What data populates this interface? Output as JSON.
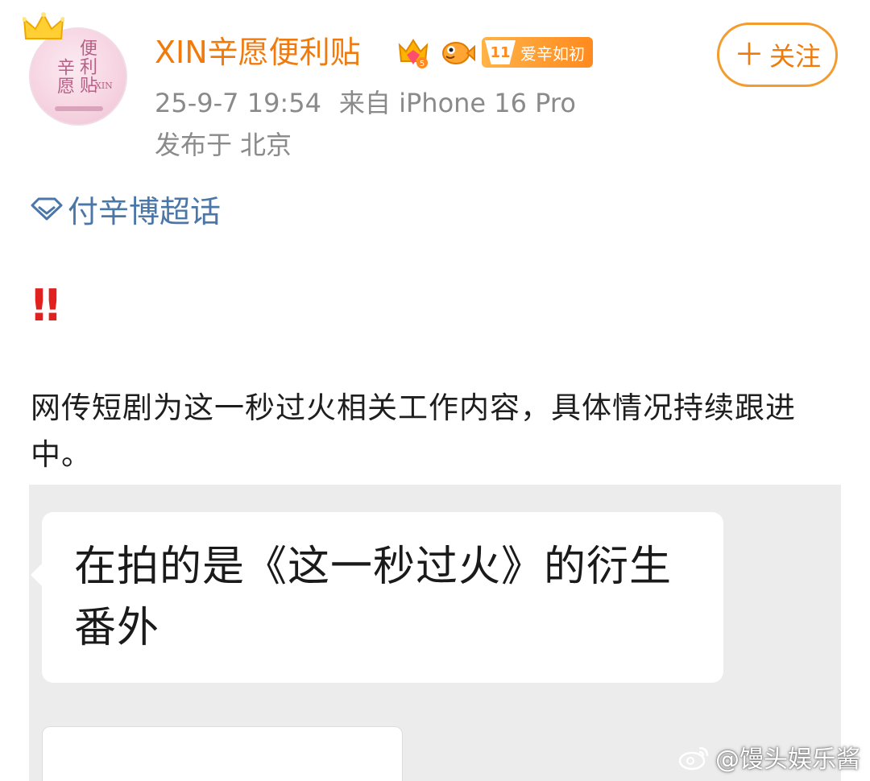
{
  "post": {
    "username": "XIN辛愿便利贴",
    "fan_badge": {
      "level": "11",
      "label": "爱辛如初"
    },
    "follow_label": "关注",
    "timestamp": "25-9-7 19:54",
    "source": "来自 iPhone 16 Pro",
    "location_prefix": "发布于",
    "location": "北京",
    "topic": "付辛博超话",
    "alert": "‼",
    "text": "网传短剧为这一秒过火相关工作内容，具体情况持续跟进中。"
  },
  "avatar": {
    "line1": "便利贴",
    "line2": "辛愿",
    "sub": "XIN"
  },
  "image": {
    "chat_message": "在拍的是《这一秒过火》的衍生番外"
  },
  "watermark": {
    "text": "@馒头娱乐酱"
  },
  "colors": {
    "username": "#f07b0c",
    "topic": "#4b77a8",
    "meta": "#8a8a8a",
    "alert": "#e0211d"
  }
}
